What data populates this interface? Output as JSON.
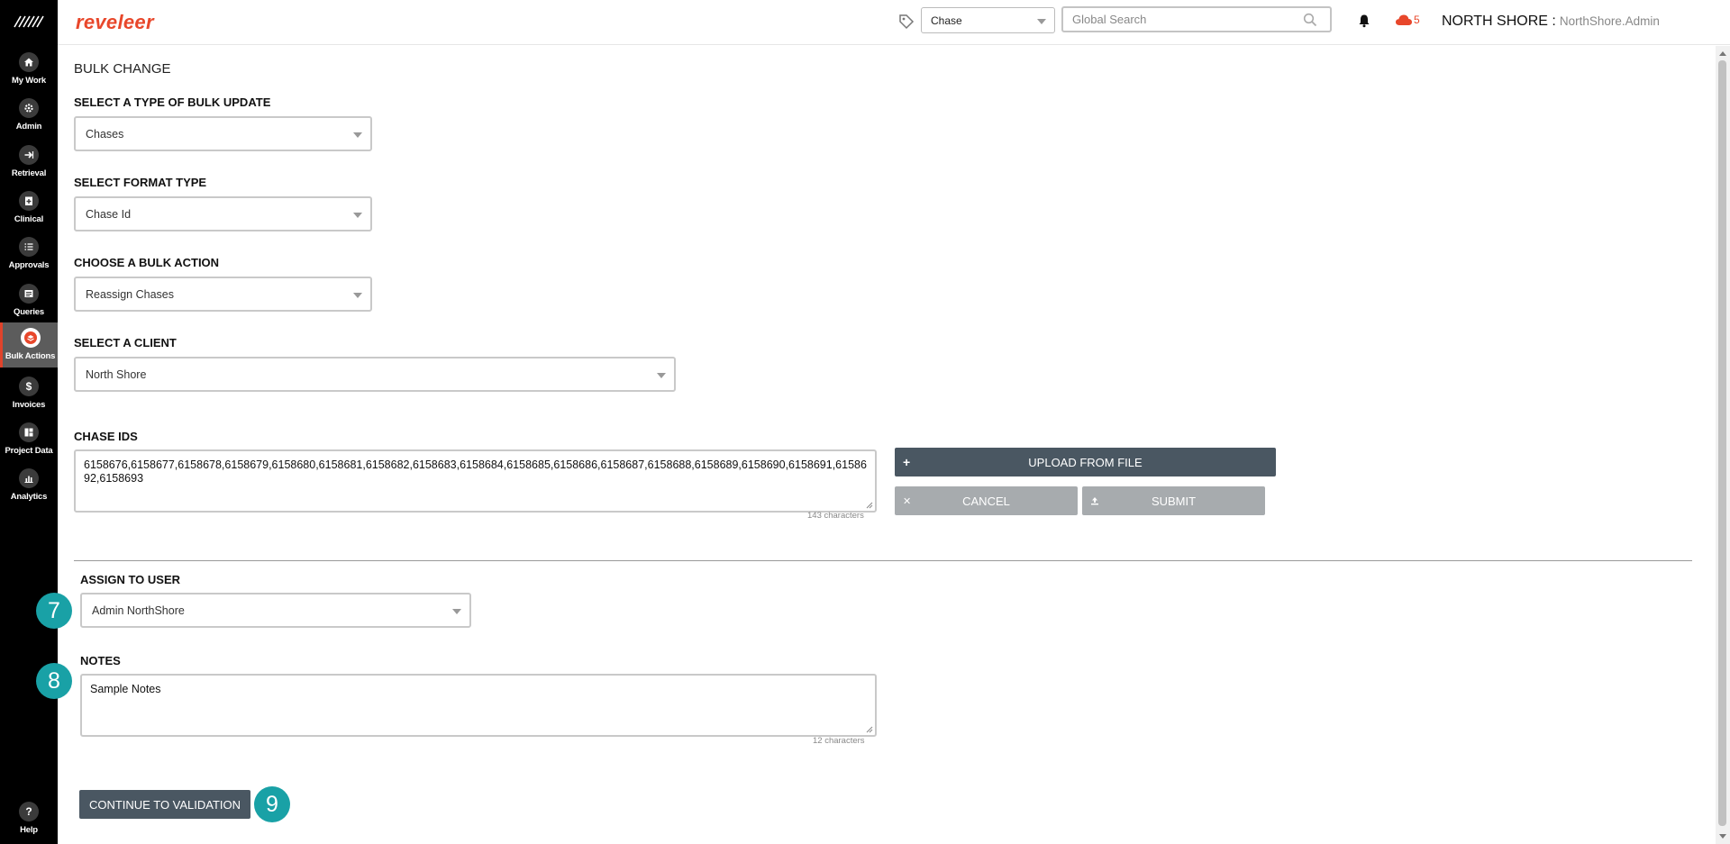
{
  "sidebar": {
    "logo_icon": "reveleer-mark-icon",
    "items": [
      {
        "label": "My Work",
        "icon": "house-icon"
      },
      {
        "label": "Admin",
        "icon": "gear-icon"
      },
      {
        "label": "Retrieval",
        "icon": "arrow-right-icon"
      },
      {
        "label": "Clinical",
        "icon": "clipboard-plus-icon"
      },
      {
        "label": "Approvals",
        "icon": "checklist-icon"
      },
      {
        "label": "Queries",
        "icon": "document-list-icon"
      },
      {
        "label": "Bulk Actions",
        "icon": "stack-icon",
        "active": true
      },
      {
        "label": "Invoices",
        "icon": "dollar-icon"
      },
      {
        "label": "Project Data",
        "icon": "grid-icon"
      },
      {
        "label": "Analytics",
        "icon": "bar-chart-icon"
      }
    ],
    "help_label": "Help",
    "help_icon": "question-icon"
  },
  "header": {
    "brand": "reveleer",
    "type_select": "Chase",
    "search_placeholder": "Global Search",
    "cloud_count": "5",
    "org": "NORTH SHORE :",
    "user": "NorthShore.Admin",
    "accent_color": "#e8472b"
  },
  "form": {
    "title": "BULK CHANGE",
    "bulk_update_label": "SELECT A TYPE OF BULK UPDATE",
    "bulk_update_value": "Chases",
    "format_type_label": "SELECT FORMAT TYPE",
    "format_type_value": "Chase Id",
    "bulk_action_label": "CHOOSE A BULK ACTION",
    "bulk_action_value": "Reassign Chases",
    "client_label": "SELECT A CLIENT",
    "client_value": "North Shore",
    "chase_ids_label": "CHASE IDS",
    "chase_ids_value": "6158676,6158677,6158678,6158679,6158680,6158681,6158682,6158683,6158684,6158685,6158686,6158687,6158688,6158689,6158690,6158691,6158692,6158693",
    "chase_ids_count": "143 characters",
    "upload_label": "UPLOAD FROM FILE",
    "cancel_label": "CANCEL",
    "submit_label": "SUBMIT",
    "assign_label": "ASSIGN TO USER",
    "assign_value": "Admin NorthShore",
    "notes_label": "NOTES",
    "notes_value": "Sample Notes",
    "notes_count": "12 characters",
    "continue_label": "CONTINUE TO VALIDATION"
  },
  "annotations": {
    "step_7": "7",
    "step_8": "8",
    "step_9": "9",
    "badge_color": "#19a1a6"
  }
}
